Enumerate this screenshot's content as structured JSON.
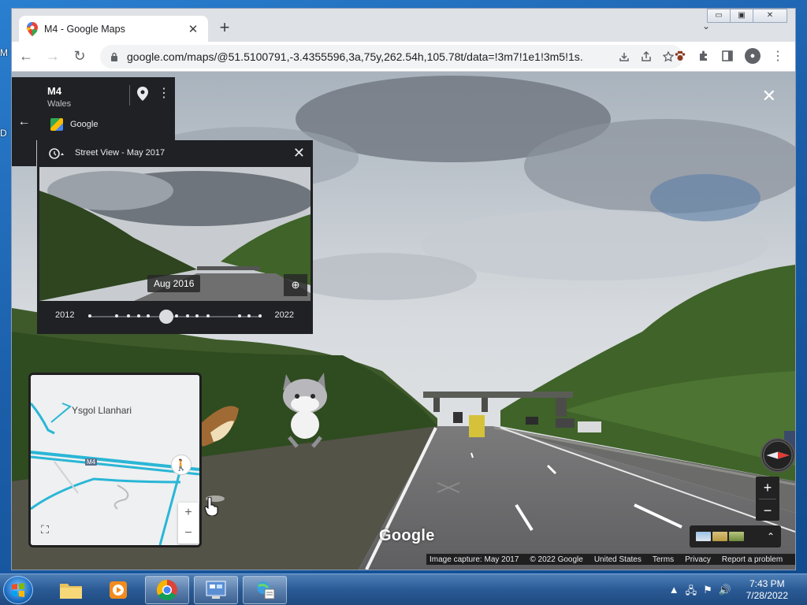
{
  "desktop": {
    "labels": [
      "M",
      "D"
    ]
  },
  "browser": {
    "tab_title": "M4 - Google Maps",
    "tab_close": "✕",
    "new_tab": "+",
    "tab_menu": "⌄",
    "window_controls": {
      "minimize": "▭",
      "maximize": "▣",
      "close": "✕"
    },
    "back_icon": "←",
    "forward_icon": "→",
    "reload_icon": "↻",
    "url": "google.com/maps/@51.5100791,-3.4355596,3a,75y,262.54h,105.78t/data=!3m7!1e1!3m5!1s...",
    "omnibox_icons": [
      "download",
      "share",
      "bookmark-star"
    ],
    "extension_icons": [
      "paw",
      "puzzle",
      "sidebar"
    ],
    "menu_icon": "⋮"
  },
  "maps": {
    "place": {
      "title": "M4",
      "subtitle": "Wales",
      "source": "Google",
      "back_icon": "←",
      "pin_icon": "📍",
      "more_icon": "⋮"
    },
    "time_panel": {
      "title": "Street View - May 2017",
      "close": "✕",
      "thumbnail_date": "Aug 2016",
      "zoom_icon": "⊕",
      "year_start": "2012",
      "year_end": "2022",
      "selected_fraction": 0.45
    },
    "exit_icon": "✕",
    "minimap": {
      "label": "Ysgol Llanhari",
      "road": "M4",
      "zoom_in": "+",
      "zoom_out": "−",
      "fullscreen": "⛶",
      "pegman": "🚶"
    },
    "controls": {
      "zoom_in": "+",
      "zoom_out": "−",
      "layers_expand": "⌃"
    },
    "watermark": "Google",
    "footer": {
      "capture": "Image capture: May 2017",
      "copyright": "© 2022 Google",
      "region": "United States",
      "terms": "Terms",
      "privacy": "Privacy",
      "report": "Report a problem"
    },
    "colors": {
      "panel": "#202124",
      "road_line": "#29b6d6"
    }
  },
  "taskbar": {
    "time": "7:43 PM",
    "date": "7/28/2022",
    "tray_icons": [
      "▲",
      "🖧",
      "⚑",
      "🔊"
    ]
  }
}
